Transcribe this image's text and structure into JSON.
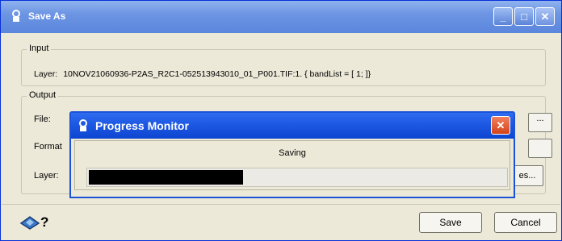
{
  "window": {
    "title": "Save As",
    "minimize_glyph": "_",
    "maximize_glyph": "□",
    "close_glyph": "✕"
  },
  "input_group": {
    "label": "Input",
    "layer_label": "Layer:",
    "layer_value": "10NOV21060936-P2AS_R2C1-052513943010_01_P001.TIF:1. { bandList = [ 1; ]}"
  },
  "output_group": {
    "label": "Output",
    "file_label": "File:",
    "format_label": "Format",
    "layer_label": "Layer:",
    "file_browse_label": "...",
    "format_button_label": "",
    "layer_button_label": "es..."
  },
  "buttons": {
    "save": "Save",
    "cancel": "Cancel"
  },
  "progress_monitor": {
    "title": "Progress Monitor",
    "close_glyph": "✕",
    "status": "Saving",
    "progress": 0.37
  },
  "colors": {
    "titlebar": "#6d95e3",
    "dialog_titlebar": "#1d58e3",
    "close_button": "#d4431a",
    "progress_fill": "#000000",
    "window_bg": "#ece9d8"
  },
  "icons": {
    "window_icon": "app-icon",
    "help": "help-icon"
  }
}
